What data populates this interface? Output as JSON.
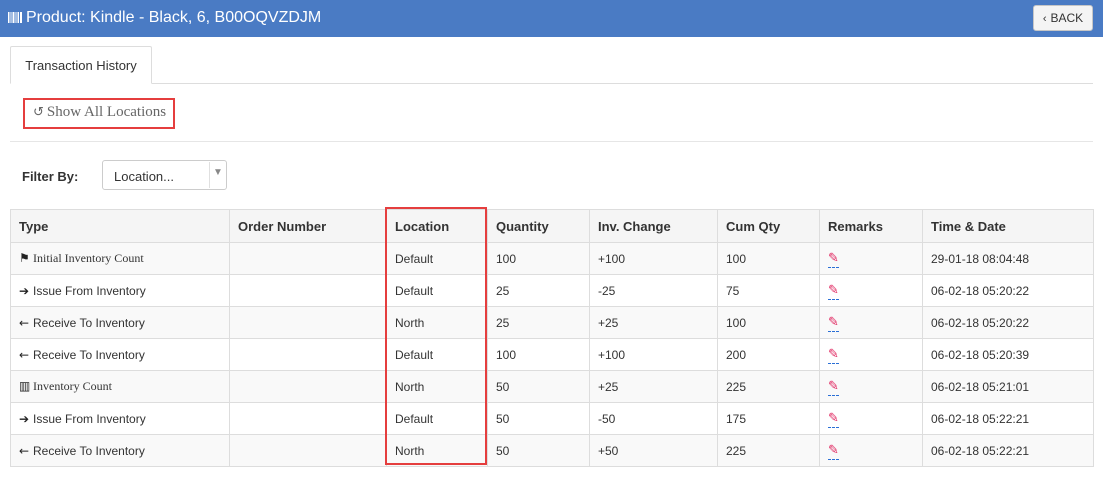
{
  "header": {
    "title": "Product: Kindle - Black, 6, B00OQVZDJM",
    "back_label": "BACK"
  },
  "tabs": [
    {
      "label": "Transaction History",
      "active": true
    }
  ],
  "show_all_label": "Show All Locations",
  "filter": {
    "label": "Filter By:",
    "location_value": "Location..."
  },
  "table": {
    "columns": [
      "Type",
      "Order Number",
      "Location",
      "Quantity",
      "Inv. Change",
      "Cum Qty",
      "Remarks",
      "Time & Date"
    ],
    "rows": [
      {
        "type": "Initial Inventory Count",
        "type_icon": "flag-icon",
        "order_number": "",
        "location": "Default",
        "quantity": "100",
        "inv_change": "+100",
        "cum_qty": "100",
        "time_date": "29-01-18 08:04:48"
      },
      {
        "type": "Issue From Inventory",
        "type_icon": "arrow-right-icon",
        "order_number": "",
        "location": "Default",
        "quantity": "25",
        "inv_change": "-25",
        "cum_qty": "75",
        "time_date": "06-02-18 05:20:22"
      },
      {
        "type": "Receive To Inventory",
        "type_icon": "arrow-left-icon",
        "order_number": "",
        "location": "North",
        "quantity": "25",
        "inv_change": "+25",
        "cum_qty": "100",
        "time_date": "06-02-18 05:20:22"
      },
      {
        "type": "Receive To Inventory",
        "type_icon": "arrow-left-icon",
        "order_number": "",
        "location": "Default",
        "quantity": "100",
        "inv_change": "+100",
        "cum_qty": "200",
        "time_date": "06-02-18 05:20:39"
      },
      {
        "type": "Inventory Count",
        "type_icon": "barcode-icon",
        "order_number": "",
        "location": "North",
        "quantity": "50",
        "inv_change": "+25",
        "cum_qty": "225",
        "time_date": "06-02-18 05:21:01"
      },
      {
        "type": "Issue From Inventory",
        "type_icon": "arrow-right-icon",
        "order_number": "",
        "location": "Default",
        "quantity": "50",
        "inv_change": "-50",
        "cum_qty": "175",
        "time_date": "06-02-18 05:22:21"
      },
      {
        "type": "Receive To Inventory",
        "type_icon": "arrow-left-icon",
        "order_number": "",
        "location": "North",
        "quantity": "50",
        "inv_change": "+50",
        "cum_qty": "225",
        "time_date": "06-02-18 05:22:21"
      }
    ]
  },
  "colors": {
    "header_bg": "#4a7bc4",
    "highlight": "#e53e3e",
    "edit_icon": "#e0245e"
  }
}
